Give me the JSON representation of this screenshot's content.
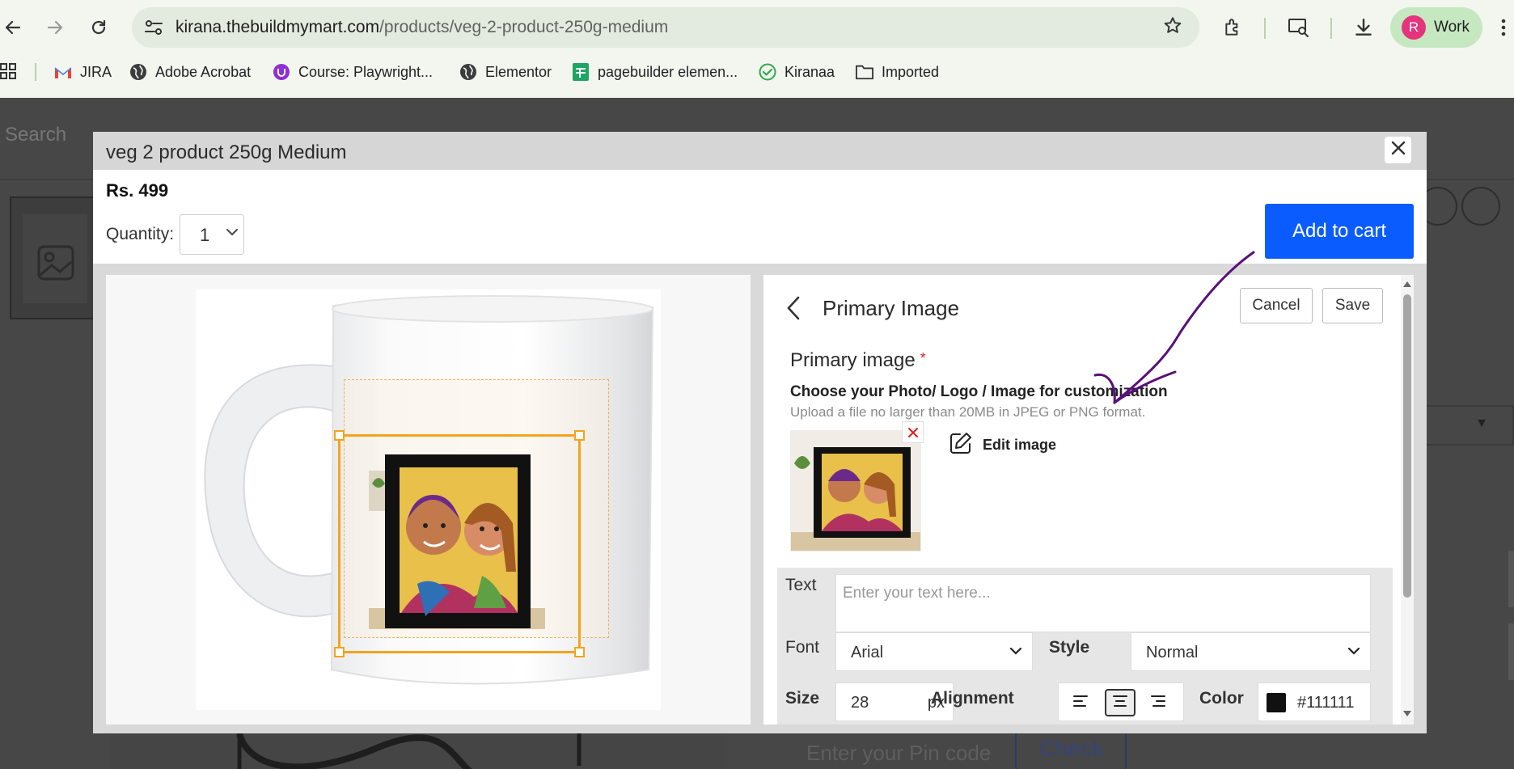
{
  "browser": {
    "url_host": "kirana.thebuildmymart.com",
    "url_path": "/products/veg-2-product-250g-medium",
    "profile_initial": "R",
    "profile_label": "Work",
    "bookmarks": [
      {
        "label": "JIRA",
        "icon": "gmail-icon"
      },
      {
        "label": "Adobe Acrobat",
        "icon": "globe-icon"
      },
      {
        "label": "Course: Playwright...",
        "icon": "udemy-icon"
      },
      {
        "label": "Elementor",
        "icon": "globe-icon"
      },
      {
        "label": "pagebuilder elemen...",
        "icon": "sheets-icon"
      },
      {
        "label": "Kiranaa",
        "icon": "check-icon"
      },
      {
        "label": "Imported",
        "icon": "folder-icon"
      }
    ]
  },
  "background": {
    "search": "Search",
    "pin_placeholder": "Enter your Pin code",
    "check": "Check"
  },
  "modal": {
    "title": "veg 2 product 250g Medium",
    "price": "Rs. 499",
    "quantity_label": "Quantity:",
    "quantity_value": "1",
    "add_to_cart": "Add to cart"
  },
  "editor": {
    "title": "Primary Image",
    "cancel": "Cancel",
    "save": "Save",
    "primary_image_label": "Primary image",
    "required_mark": "*",
    "choose_text": "Choose your Photo/ Logo / Image for customization",
    "hint_text": "Upload a file no larger than 20MB in JPEG or PNG format.",
    "edit_image": "Edit image",
    "text_label": "Text",
    "text_placeholder": "Enter your text here...",
    "font_label": "Font",
    "font_value": "Arial",
    "style_label": "Style",
    "style_value": "Normal",
    "size_label": "Size",
    "size_value": "28",
    "size_unit": "px",
    "alignment_label": "Alignment",
    "alignment_selected": "center",
    "color_label": "Color",
    "color_value": "#111111"
  },
  "colors": {
    "accent": "#0b5cff",
    "selection": "#f4a31c",
    "annotation": "#5a0f7a"
  }
}
